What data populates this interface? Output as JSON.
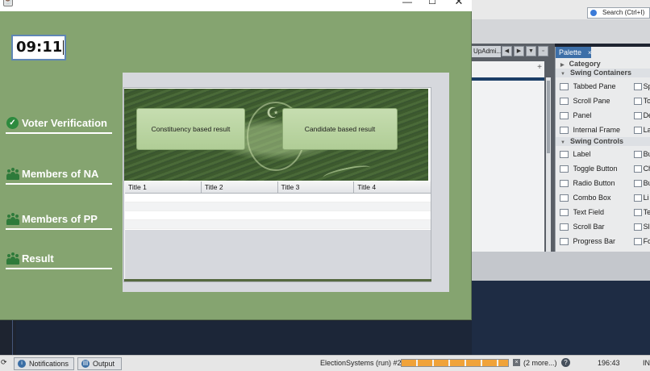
{
  "app": {
    "window_controls": {
      "minimize": "—",
      "maximize": "☐",
      "close": "✕"
    },
    "time_value": "09:11",
    "nav": [
      {
        "label": "Voter Verification",
        "icon": "check-circle-icon"
      },
      {
        "label": "Members of NA",
        "icon": "people-icon"
      },
      {
        "label": "Members of PP",
        "icon": "people-icon"
      },
      {
        "label": "Result",
        "icon": "people-icon"
      }
    ],
    "buttons": {
      "constituency": "Constituency based result",
      "candidate": "Candidate based result"
    },
    "table": {
      "columns": [
        "Title 1",
        "Title 2",
        "Title 3",
        "Title 4"
      ],
      "rows": []
    },
    "colors": {
      "background": "#85a470",
      "nav_text": "#ffffff",
      "button": "#b9d2a0"
    }
  },
  "ide": {
    "search_placeholder": "Search (Ctrl+I)",
    "editor_tab": "UpAdmi...",
    "palette": {
      "title": "Palette",
      "categories": [
        {
          "name": "Category",
          "items": []
        },
        {
          "name": "Swing Containers",
          "items": [
            {
              "label": "Tabbed Pane",
              "right": "Sp"
            },
            {
              "label": "Scroll Pane",
              "right": "To"
            },
            {
              "label": "Panel",
              "right": "De"
            },
            {
              "label": "Internal Frame",
              "right": "La"
            }
          ]
        },
        {
          "name": "Swing Controls",
          "items": [
            {
              "label": "Label",
              "right": "Bu"
            },
            {
              "label": "Toggle Button",
              "right": "Ch"
            },
            {
              "label": "Radio Button",
              "right": "Bu"
            },
            {
              "label": "Combo Box",
              "right": "Li"
            },
            {
              "label": "Text Field",
              "right": "Te"
            },
            {
              "label": "Scroll Bar",
              "right": "Sl"
            },
            {
              "label": "Progress Bar",
              "right": "Fo"
            }
          ]
        }
      ]
    },
    "status": {
      "notifications": "Notifications",
      "output": "Output",
      "run_task": "ElectionSystems (run) #2",
      "more": "(2 more...)",
      "position": "196:43",
      "mode": "IN"
    }
  }
}
